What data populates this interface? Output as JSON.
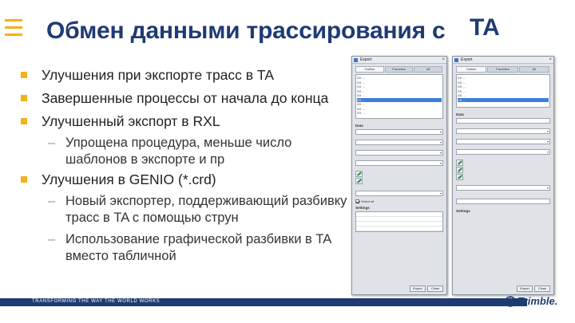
{
  "slide": {
    "title": "Обмен данными трассирования с",
    "title_overlap": "TA",
    "bullets": [
      {
        "text": "Улучшения при экспорте трасс в TA"
      },
      {
        "text": "Завершенные процессы от начала до конца"
      },
      {
        "text": "Улучшенный экспорт в RXL"
      },
      {
        "sub": "Упрощена процедура, меньше число шаблонов в экспорте и пр"
      },
      {
        "text": "Улучшения в GENIO (*.crd)"
      },
      {
        "sub": "Новый экспортер, поддерживающий разбивку трасс в TA с помощью струн"
      },
      {
        "sub": "Использование графической разбивки в TA вместо табличной"
      }
    ],
    "footer_text": "TRANSFORMING THE WAY THE WORLD WORKS",
    "logo_text": "Trimble.",
    "accent_color": "#f2b21a",
    "brand_color": "#1f3b73"
  },
  "dialog_left": {
    "title": "Export",
    "tabs": [
      "Outline",
      "Favorites",
      "All"
    ],
    "files": [
      "XX  ...",
      "XX  ...",
      "XX  ...",
      "XX  ...",
      "XX  ...",
      "XX  ...",
      "XX  ...",
      "XX  ...",
      "XX  ..."
    ],
    "section_data": "Data",
    "section_settings": "Settings",
    "checkbox_label": "Select all"
  },
  "dialog_right": {
    "title": "Export",
    "tabs": [
      "Outline",
      "Favorites",
      "All"
    ],
    "files": [
      "XX  ...",
      "XX  ...",
      "XX  ...",
      "XX  ...",
      "XX  ...",
      "XX  ..."
    ],
    "section_data": "Data",
    "section_settings": "Settings"
  },
  "buttons": {
    "export": "Export",
    "close": "Close"
  }
}
